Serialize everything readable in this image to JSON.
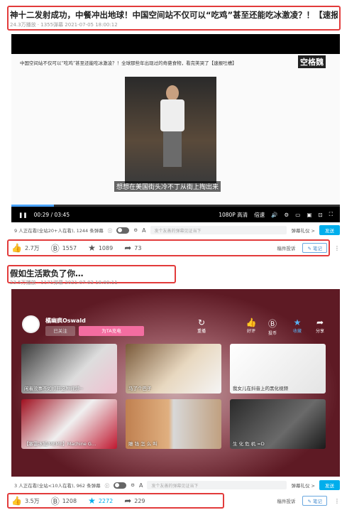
{
  "video1": {
    "title": "神十二发射成功，中餐冲出地球！中国空间站不仅可以“吃鸡”甚至还能吃冰激凌？！【速报…",
    "meta": "24.3万播放 · 1355弹幕   2021-07-05 18:00:12",
    "inner_caption": "中国空间站不仅可以“吃鸡”甚至还能吃冰激凌？！全球那些年出现过的奇葩食物，看完笑哭了【速报吐槽】",
    "brand": "空格魏",
    "subtitle": "想想在美国街头冷不丁从街上掏出来",
    "time": "00:29 / 03:45",
    "quality": "1080P 高清",
    "speed": "倍速",
    "watching": "9 人正在看(全站20+人在看), 1244 条弹幕",
    "dm_placeholder": "发个友善的弹幕见证当下",
    "dm_etiquette": "弹幕礼仪 >",
    "send": "发送",
    "likes": "2.7万",
    "coins": "1557",
    "favs": "1089",
    "shares": "73",
    "report": "稿件投诉",
    "note": "笔记"
  },
  "video2": {
    "title": "假如生活欺负了你…",
    "meta": "23.5万播放 · 1171弹幕   2021-07-03 18:00:11",
    "up_name": "橘幽疯Oswald",
    "followed": "已关注",
    "charge": "为TA充电",
    "replay": "重播",
    "good": "好评",
    "coin": "投币",
    "fav": "收藏",
    "share": "分享",
    "thumbs": [
      {
        "caption": "闲着没事不如打开这种视频~"
      },
      {
        "caption": "马了个巴子"
      },
      {
        "caption": "我女儿在抖音上的黑化视频"
      },
      {
        "caption": "【塞雷冰城/MEME】Machine G…"
      },
      {
        "caption": "雕 钱 怎 么 叫"
      },
      {
        "caption": "生 化 危 机 =D"
      }
    ],
    "watching": "3 人正在看(全站<10人在看), 962 条弹幕",
    "dm_placeholder": "发个友善的弹幕见证当下",
    "dm_etiquette": "弹幕礼仪 >",
    "send": "发送",
    "likes": "3.5万",
    "coins": "1208",
    "favs": "2272",
    "shares": "229",
    "report": "稿件投诉",
    "note": "笔记"
  },
  "colors": {
    "highlight": "#e23b3b",
    "accent": "#00aeec",
    "pink": "#f36da0"
  }
}
